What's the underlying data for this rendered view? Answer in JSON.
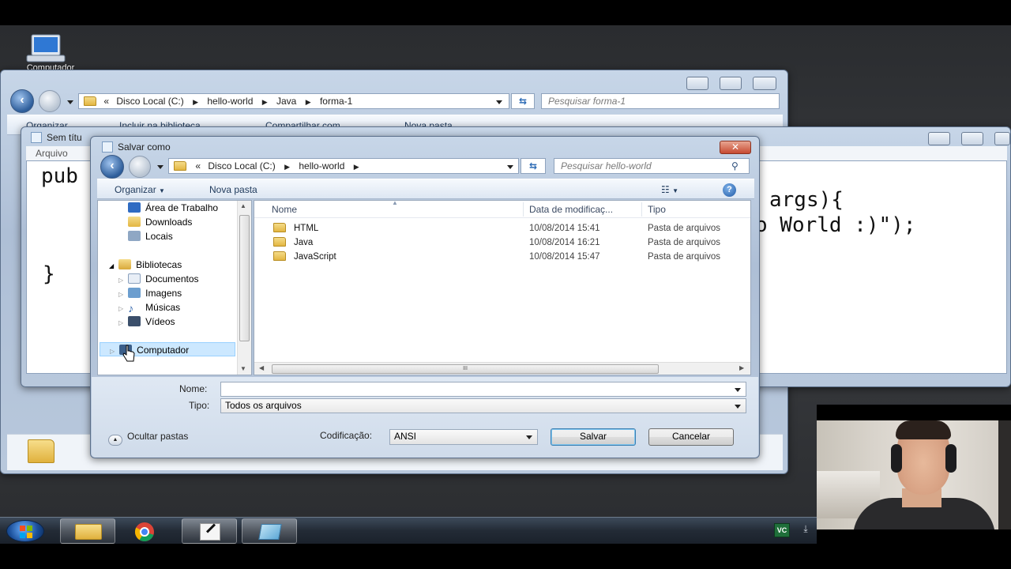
{
  "desktop": {
    "computer_icon_label": "Computador"
  },
  "explorer": {
    "address": {
      "chevrons": "«",
      "crumbs": [
        "Disco Local (C:)",
        "hello-world",
        "Java",
        "forma-1"
      ]
    },
    "search_placeholder": "Pesquisar forma-1",
    "toolbar": {
      "organize": "Organizar",
      "include_library": "Incluir na biblioteca",
      "share_with": "Compartilhar com",
      "new_folder": "Nova pasta"
    }
  },
  "notepad": {
    "title": "Sem títu",
    "menu_file": "Arquivo",
    "code_line1": "pub",
    "code_line2": "}",
    "code_right1": "args){",
    "code_right2": "o World :)\");"
  },
  "dialog": {
    "title": "Salvar como",
    "address": {
      "chevrons": "«",
      "crumbs": [
        "Disco Local (C:)",
        "hello-world"
      ]
    },
    "search_placeholder": "Pesquisar hello-world",
    "toolbar": {
      "organize": "Organizar",
      "new_folder": "Nova pasta"
    },
    "tree": {
      "favorites": [
        "Área de Trabalho",
        "Downloads",
        "Locais"
      ],
      "libraries_label": "Bibliotecas",
      "libraries": [
        "Documentos",
        "Imagens",
        "Músicas",
        "Vídeos"
      ],
      "computer_label": "Computador"
    },
    "columns": {
      "name": "Nome",
      "modified": "Data de modificaç...",
      "type": "Tipo"
    },
    "files": [
      {
        "name": "HTML",
        "modified": "10/08/2014 15:41",
        "type": "Pasta de arquivos"
      },
      {
        "name": "Java",
        "modified": "10/08/2014 16:21",
        "type": "Pasta de arquivos"
      },
      {
        "name": "JavaScript",
        "modified": "10/08/2014 15:47",
        "type": "Pasta de arquivos"
      }
    ],
    "scroll_grip": "III",
    "filename_label": "Nome:",
    "filename_value": "",
    "filetype_label": "Tipo:",
    "filetype_value": "Todos os arquivos",
    "hide_folders": "Ocultar pastas",
    "encoding_label": "Codificação:",
    "encoding_value": "ANSI",
    "save_button": "Salvar",
    "cancel_button": "Cancelar"
  },
  "colors": {
    "accent": "#2d5d9a",
    "selection": "#cce8ff"
  }
}
